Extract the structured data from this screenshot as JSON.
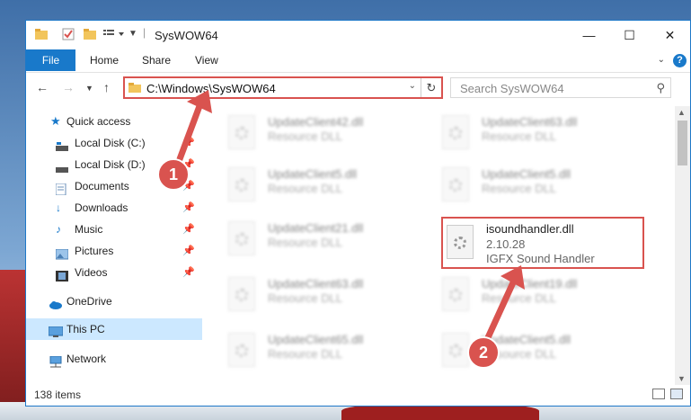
{
  "window": {
    "title": "SysWOW64",
    "controls": {
      "minimize": "—",
      "maximize": "☐",
      "close": "✕"
    }
  },
  "ribbon": {
    "tabs": [
      "File",
      "Home",
      "Share",
      "View"
    ],
    "help": "?"
  },
  "address": {
    "path": "C:\\Windows\\SysWOW64",
    "search_placeholder": "Search SysWOW64"
  },
  "nav": {
    "items": [
      {
        "label": "Quick access",
        "icon": "star-icon"
      },
      {
        "label": "Local Disk (C:)",
        "icon": "drive-icon",
        "pinned": true
      },
      {
        "label": "Local Disk (D:)",
        "icon": "drive-icon",
        "pinned": true
      },
      {
        "label": "Documents",
        "icon": "document-icon",
        "pinned": true
      },
      {
        "label": "Downloads",
        "icon": "download-icon",
        "pinned": true
      },
      {
        "label": "Music",
        "icon": "music-icon",
        "pinned": true
      },
      {
        "label": "Pictures",
        "icon": "pictures-icon",
        "pinned": true
      },
      {
        "label": "Videos",
        "icon": "video-icon",
        "pinned": true
      },
      {
        "label": "OneDrive",
        "icon": "cloud-icon"
      },
      {
        "label": "This PC",
        "icon": "computer-icon",
        "selected": true
      },
      {
        "label": "Network",
        "icon": "network-icon"
      }
    ]
  },
  "files": [
    {
      "name": "UpdateClient42.dll",
      "type": "Resource DLL"
    },
    {
      "name": "UpdateClient63.dll",
      "type": "Resource DLL"
    },
    {
      "name": "UpdateClient5.dll",
      "type": "Resource DLL"
    },
    {
      "name": "UpdateClient5.dll",
      "type": "Resource DLL"
    },
    {
      "name": "UpdateClient21.dll",
      "type": "Resource DLL"
    },
    {
      "name": "isoundhandler.dll",
      "version": "2.10.28",
      "description": "IGFX Sound Handler"
    },
    {
      "name": "UpdateClient63.dll",
      "type": "Resource DLL"
    },
    {
      "name": "UpdateClient19.dll",
      "type": "Resource DLL"
    },
    {
      "name": "UpdateClient65.dll",
      "type": "Resource DLL"
    },
    {
      "name": "UpdateClient5.dll",
      "type": "Resource DLL"
    }
  ],
  "status": {
    "items": "138 items"
  },
  "callouts": {
    "one": "1",
    "two": "2"
  },
  "colors": {
    "accent": "#1979ca",
    "highlight": "#d9534f",
    "selected": "#cce8ff"
  }
}
